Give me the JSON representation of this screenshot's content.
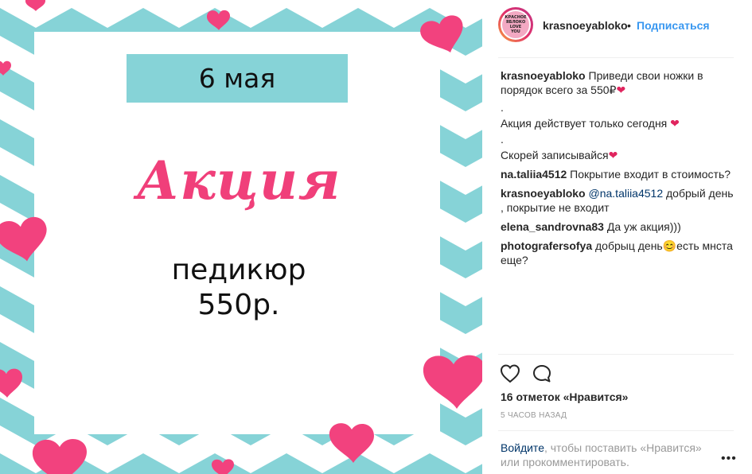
{
  "post_image": {
    "date": "6 мая",
    "title": "Акция",
    "service": "педикюр",
    "price": "550р.",
    "colors": {
      "teal": "#86d3d7",
      "pink": "#f03f7a",
      "heart": "#f2427e"
    }
  },
  "header": {
    "username": "krasnoeyabloko",
    "separator": "•",
    "follow_label": "Подписаться",
    "avatar_text": [
      "КРАСНОЕ",
      "ЯБЛОКО",
      "LOVE",
      "YOU"
    ]
  },
  "comments": [
    {
      "user": "krasnoeyabloko",
      "text": "Приведи свои ножки в порядок всего за 550₽",
      "emoji": "❤"
    },
    {
      "user": "",
      "text": "."
    },
    {
      "user": "",
      "text": "Акция действует только сегодня ",
      "emoji": "❤"
    },
    {
      "user": "",
      "text": "."
    },
    {
      "user": "",
      "text": "Скорей записывайся",
      "emoji": "❤"
    },
    {
      "user": "na.taliia4512",
      "text": "Покрытие входит в стоимость?"
    },
    {
      "user": "krasnoeyabloko",
      "mention": "@na.taliia4512",
      "text": " добрый день , покрытие не входит"
    },
    {
      "user": "elena_sandrovna83",
      "text": "Да уж акция)))"
    },
    {
      "user": "photografersofya",
      "text": "добрыц день",
      "emoji": "😊",
      "text2": "есть мнста еще?"
    }
  ],
  "actions": {
    "like_icon": "heart-outline-icon",
    "comment_icon": "comment-bubble-icon"
  },
  "likes": "16 отметок «Нравится»",
  "timestamp": "5 ЧАСОВ НАЗАД",
  "login_prompt": {
    "link": "Войдите",
    "text": ", чтобы поставить «Нравится» или прокомментировать."
  },
  "more_label": "•••"
}
